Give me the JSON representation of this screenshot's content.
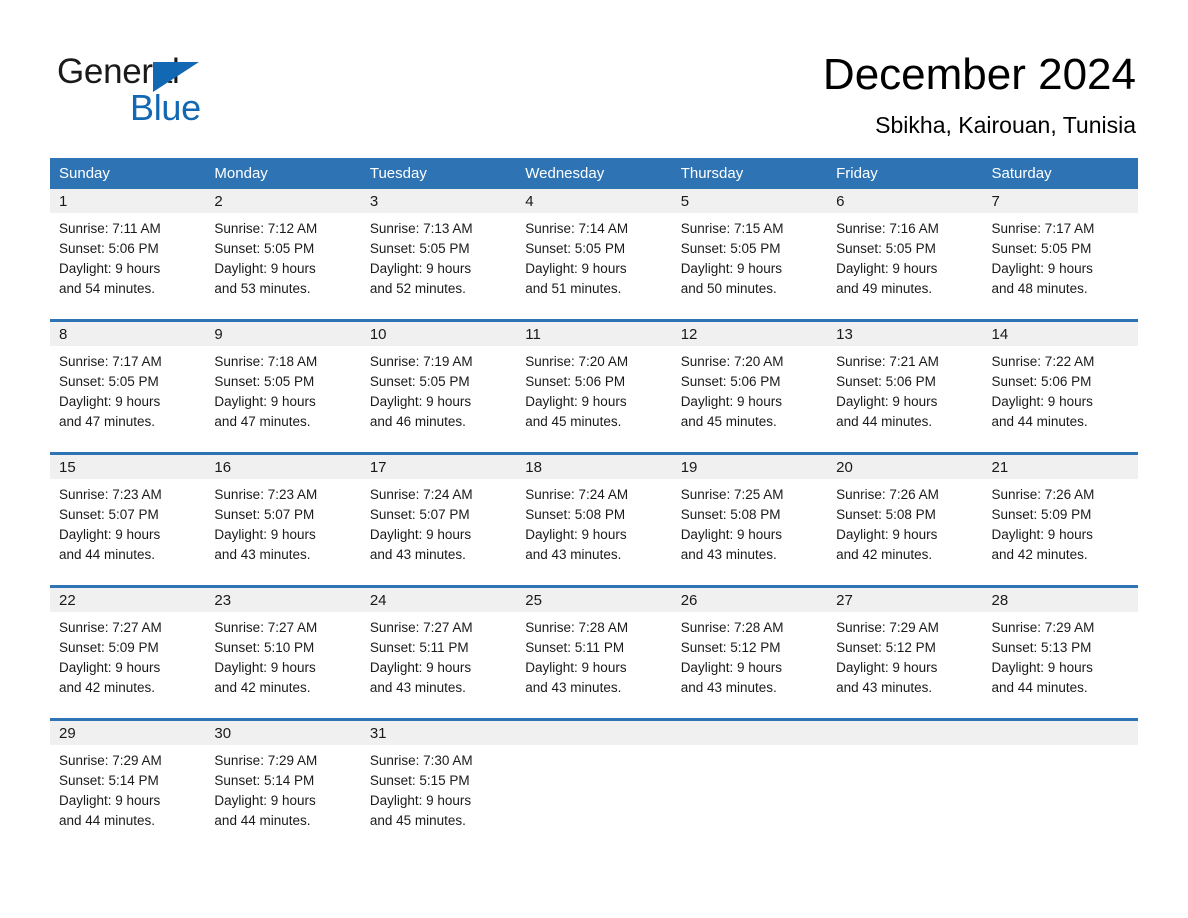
{
  "brand": {
    "name_top": "General",
    "name_bottom": "Blue",
    "accent_color": "#1268b3"
  },
  "header": {
    "title": "December 2024",
    "location": "Sbikha, Kairouan, Tunisia"
  },
  "calendar": {
    "header_bg": "#2e74b5",
    "daynum_bg": "#f0f0f0",
    "weekdays": [
      "Sunday",
      "Monday",
      "Tuesday",
      "Wednesday",
      "Thursday",
      "Friday",
      "Saturday"
    ],
    "weeks": [
      [
        {
          "day": "1",
          "sunrise": "Sunrise: 7:11 AM",
          "sunset": "Sunset: 5:06 PM",
          "daylight_1": "Daylight: 9 hours",
          "daylight_2": "and 54 minutes."
        },
        {
          "day": "2",
          "sunrise": "Sunrise: 7:12 AM",
          "sunset": "Sunset: 5:05 PM",
          "daylight_1": "Daylight: 9 hours",
          "daylight_2": "and 53 minutes."
        },
        {
          "day": "3",
          "sunrise": "Sunrise: 7:13 AM",
          "sunset": "Sunset: 5:05 PM",
          "daylight_1": "Daylight: 9 hours",
          "daylight_2": "and 52 minutes."
        },
        {
          "day": "4",
          "sunrise": "Sunrise: 7:14 AM",
          "sunset": "Sunset: 5:05 PM",
          "daylight_1": "Daylight: 9 hours",
          "daylight_2": "and 51 minutes."
        },
        {
          "day": "5",
          "sunrise": "Sunrise: 7:15 AM",
          "sunset": "Sunset: 5:05 PM",
          "daylight_1": "Daylight: 9 hours",
          "daylight_2": "and 50 minutes."
        },
        {
          "day": "6",
          "sunrise": "Sunrise: 7:16 AM",
          "sunset": "Sunset: 5:05 PM",
          "daylight_1": "Daylight: 9 hours",
          "daylight_2": "and 49 minutes."
        },
        {
          "day": "7",
          "sunrise": "Sunrise: 7:17 AM",
          "sunset": "Sunset: 5:05 PM",
          "daylight_1": "Daylight: 9 hours",
          "daylight_2": "and 48 minutes."
        }
      ],
      [
        {
          "day": "8",
          "sunrise": "Sunrise: 7:17 AM",
          "sunset": "Sunset: 5:05 PM",
          "daylight_1": "Daylight: 9 hours",
          "daylight_2": "and 47 minutes."
        },
        {
          "day": "9",
          "sunrise": "Sunrise: 7:18 AM",
          "sunset": "Sunset: 5:05 PM",
          "daylight_1": "Daylight: 9 hours",
          "daylight_2": "and 47 minutes."
        },
        {
          "day": "10",
          "sunrise": "Sunrise: 7:19 AM",
          "sunset": "Sunset: 5:05 PM",
          "daylight_1": "Daylight: 9 hours",
          "daylight_2": "and 46 minutes."
        },
        {
          "day": "11",
          "sunrise": "Sunrise: 7:20 AM",
          "sunset": "Sunset: 5:06 PM",
          "daylight_1": "Daylight: 9 hours",
          "daylight_2": "and 45 minutes."
        },
        {
          "day": "12",
          "sunrise": "Sunrise: 7:20 AM",
          "sunset": "Sunset: 5:06 PM",
          "daylight_1": "Daylight: 9 hours",
          "daylight_2": "and 45 minutes."
        },
        {
          "day": "13",
          "sunrise": "Sunrise: 7:21 AM",
          "sunset": "Sunset: 5:06 PM",
          "daylight_1": "Daylight: 9 hours",
          "daylight_2": "and 44 minutes."
        },
        {
          "day": "14",
          "sunrise": "Sunrise: 7:22 AM",
          "sunset": "Sunset: 5:06 PM",
          "daylight_1": "Daylight: 9 hours",
          "daylight_2": "and 44 minutes."
        }
      ],
      [
        {
          "day": "15",
          "sunrise": "Sunrise: 7:23 AM",
          "sunset": "Sunset: 5:07 PM",
          "daylight_1": "Daylight: 9 hours",
          "daylight_2": "and 44 minutes."
        },
        {
          "day": "16",
          "sunrise": "Sunrise: 7:23 AM",
          "sunset": "Sunset: 5:07 PM",
          "daylight_1": "Daylight: 9 hours",
          "daylight_2": "and 43 minutes."
        },
        {
          "day": "17",
          "sunrise": "Sunrise: 7:24 AM",
          "sunset": "Sunset: 5:07 PM",
          "daylight_1": "Daylight: 9 hours",
          "daylight_2": "and 43 minutes."
        },
        {
          "day": "18",
          "sunrise": "Sunrise: 7:24 AM",
          "sunset": "Sunset: 5:08 PM",
          "daylight_1": "Daylight: 9 hours",
          "daylight_2": "and 43 minutes."
        },
        {
          "day": "19",
          "sunrise": "Sunrise: 7:25 AM",
          "sunset": "Sunset: 5:08 PM",
          "daylight_1": "Daylight: 9 hours",
          "daylight_2": "and 43 minutes."
        },
        {
          "day": "20",
          "sunrise": "Sunrise: 7:26 AM",
          "sunset": "Sunset: 5:08 PM",
          "daylight_1": "Daylight: 9 hours",
          "daylight_2": "and 42 minutes."
        },
        {
          "day": "21",
          "sunrise": "Sunrise: 7:26 AM",
          "sunset": "Sunset: 5:09 PM",
          "daylight_1": "Daylight: 9 hours",
          "daylight_2": "and 42 minutes."
        }
      ],
      [
        {
          "day": "22",
          "sunrise": "Sunrise: 7:27 AM",
          "sunset": "Sunset: 5:09 PM",
          "daylight_1": "Daylight: 9 hours",
          "daylight_2": "and 42 minutes."
        },
        {
          "day": "23",
          "sunrise": "Sunrise: 7:27 AM",
          "sunset": "Sunset: 5:10 PM",
          "daylight_1": "Daylight: 9 hours",
          "daylight_2": "and 42 minutes."
        },
        {
          "day": "24",
          "sunrise": "Sunrise: 7:27 AM",
          "sunset": "Sunset: 5:11 PM",
          "daylight_1": "Daylight: 9 hours",
          "daylight_2": "and 43 minutes."
        },
        {
          "day": "25",
          "sunrise": "Sunrise: 7:28 AM",
          "sunset": "Sunset: 5:11 PM",
          "daylight_1": "Daylight: 9 hours",
          "daylight_2": "and 43 minutes."
        },
        {
          "day": "26",
          "sunrise": "Sunrise: 7:28 AM",
          "sunset": "Sunset: 5:12 PM",
          "daylight_1": "Daylight: 9 hours",
          "daylight_2": "and 43 minutes."
        },
        {
          "day": "27",
          "sunrise": "Sunrise: 7:29 AM",
          "sunset": "Sunset: 5:12 PM",
          "daylight_1": "Daylight: 9 hours",
          "daylight_2": "and 43 minutes."
        },
        {
          "day": "28",
          "sunrise": "Sunrise: 7:29 AM",
          "sunset": "Sunset: 5:13 PM",
          "daylight_1": "Daylight: 9 hours",
          "daylight_2": "and 44 minutes."
        }
      ],
      [
        {
          "day": "29",
          "sunrise": "Sunrise: 7:29 AM",
          "sunset": "Sunset: 5:14 PM",
          "daylight_1": "Daylight: 9 hours",
          "daylight_2": "and 44 minutes."
        },
        {
          "day": "30",
          "sunrise": "Sunrise: 7:29 AM",
          "sunset": "Sunset: 5:14 PM",
          "daylight_1": "Daylight: 9 hours",
          "daylight_2": "and 44 minutes."
        },
        {
          "day": "31",
          "sunrise": "Sunrise: 7:30 AM",
          "sunset": "Sunset: 5:15 PM",
          "daylight_1": "Daylight: 9 hours",
          "daylight_2": "and 45 minutes."
        },
        {
          "day": "",
          "sunrise": "",
          "sunset": "",
          "daylight_1": "",
          "daylight_2": "",
          "empty": true
        },
        {
          "day": "",
          "sunrise": "",
          "sunset": "",
          "daylight_1": "",
          "daylight_2": "",
          "empty": true
        },
        {
          "day": "",
          "sunrise": "",
          "sunset": "",
          "daylight_1": "",
          "daylight_2": "",
          "empty": true
        },
        {
          "day": "",
          "sunrise": "",
          "sunset": "",
          "daylight_1": "",
          "daylight_2": "",
          "empty": true
        }
      ]
    ]
  }
}
